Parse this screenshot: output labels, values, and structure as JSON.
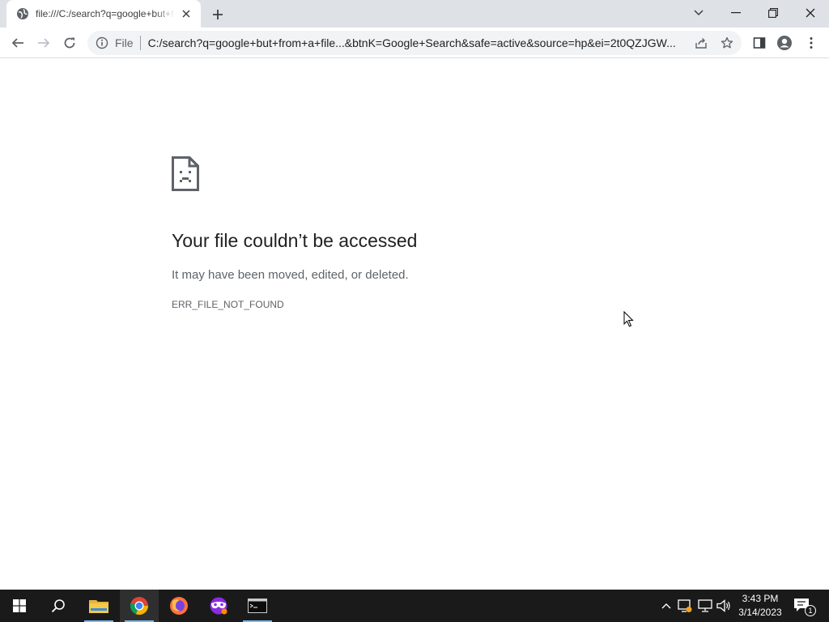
{
  "browser": {
    "tab": {
      "title": "file:///C:/search?q=google+but+from+a+file"
    },
    "omnibox": {
      "chip": "File",
      "url": "C:/search?q=google+but+from+a+file...&btnK=Google+Search&safe=active&source=hp&ei=2t0QZJGW..."
    }
  },
  "error_page": {
    "title": "Your file couldn’t be accessed",
    "description": "It may have been moved, edited, or deleted.",
    "code": "ERR_FILE_NOT_FOUND"
  },
  "taskbar": {
    "apps": [
      "start",
      "search",
      "file-explorer",
      "chrome",
      "firefox",
      "tor-browser",
      "terminal"
    ],
    "active_app": "chrome",
    "clock": {
      "time": "3:43 PM",
      "date": "3/14/2023"
    },
    "notification_count": "1"
  },
  "colors": {
    "tabstrip": "#dee1e6",
    "taskbar": "#1a1a1a",
    "accent_underline": "#76b9ed"
  }
}
